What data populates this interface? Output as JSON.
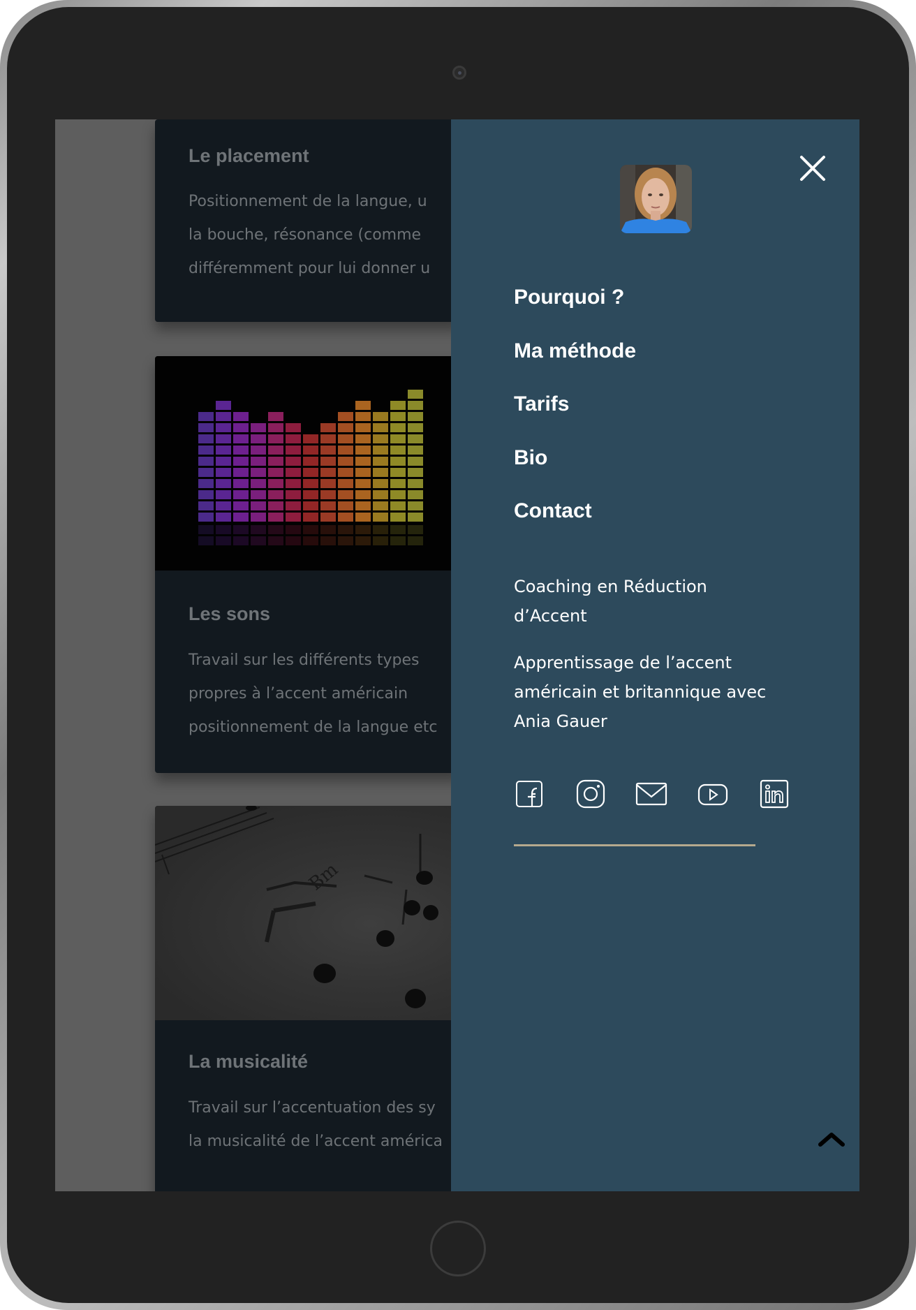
{
  "cards": [
    {
      "title": "Le placement",
      "text": "Positionnement de la langue, u\nla  bouche,  résonance  (comme\ndifféremment pour lui donner u"
    },
    {
      "title": "Les sons",
      "text": "Travail   sur   les   différents   types\npropres   à   l’accent   américain\npositionnement de la langue etc"
    },
    {
      "title": "La musicalité",
      "text": "Travail sur l’accentuation des sy\nla musicalité de l’accent américa"
    }
  ],
  "sheet_music_annotation": "Bm",
  "menu": {
    "close_icon": "close-icon",
    "avatar_alt": "Ania Gauer",
    "nav": [
      "Pourquoi ?",
      "Ma méthode",
      "Tarifs",
      "Bio",
      "Contact"
    ],
    "tagline_1": "Coaching en Réduction d’Accent",
    "tagline_2": "Apprentissage de l’accent américain et britannique avec Ania Gauer",
    "social": [
      "facebook-icon",
      "instagram-icon",
      "mail-icon",
      "youtube-icon",
      "linkedin-icon"
    ],
    "scroll_top_icon": "chevron-up-icon"
  },
  "colors": {
    "menu_background": "#2d4a5c",
    "card_background": "#12191f",
    "divider": "#b5a98e",
    "menu_text": "#ffffff"
  }
}
